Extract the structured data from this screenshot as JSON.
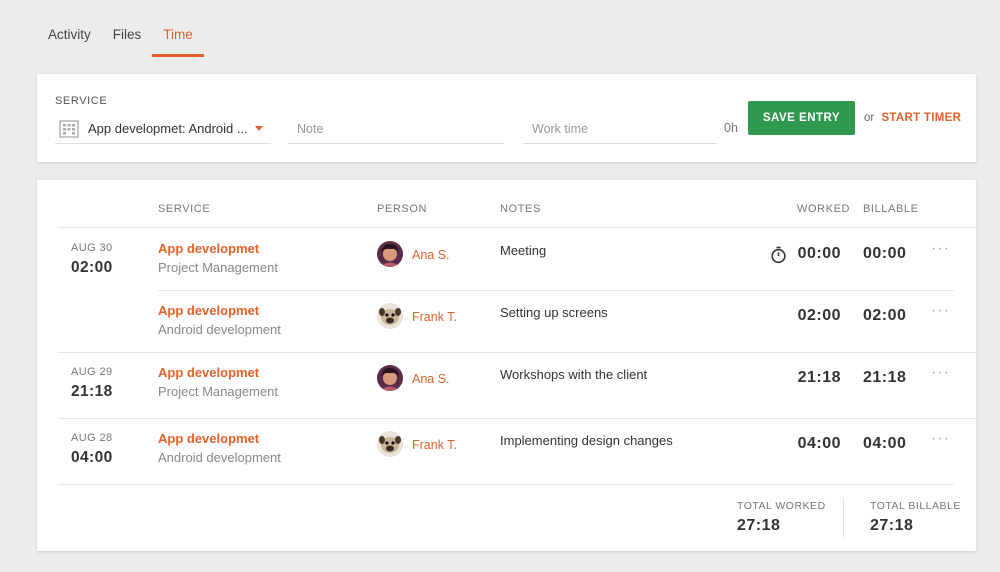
{
  "tabs": [
    {
      "label": "Activity",
      "active": false
    },
    {
      "label": "Files",
      "active": false
    },
    {
      "label": "Time",
      "active": true
    }
  ],
  "entry": {
    "service_label": "SERVICE",
    "service_value": "App developmet: Android ...",
    "note_placeholder": "Note",
    "work_placeholder": "Work time",
    "hours": "0h",
    "save_label": "SAVE ENTRY",
    "or_label": "or",
    "timer_label": "START TIMER"
  },
  "table": {
    "headers": {
      "service": "SERVICE",
      "person": "PERSON",
      "notes": "NOTES",
      "worked": "WORKED",
      "billable": "BILLABLE"
    },
    "rows": [
      {
        "date": "AUG 30",
        "time": "02:00",
        "service": "App developmet",
        "subservice": "Project Management",
        "person": "Ana S.",
        "avatar": "ana",
        "note": "Meeting",
        "worked": "00:00",
        "billable": "00:00",
        "timer_icon": true
      },
      {
        "date": "",
        "time": "",
        "service": "App developmet",
        "subservice": "Android development",
        "person": "Frank T.",
        "avatar": "frank",
        "note": "Setting up screens",
        "worked": "02:00",
        "billable": "02:00",
        "timer_icon": false
      },
      {
        "date": "AUG 29",
        "time": "21:18",
        "service": "App developmet",
        "subservice": "Project Management",
        "person": "Ana S.",
        "avatar": "ana",
        "note": "Workshops with the client",
        "worked": "21:18",
        "billable": "21:18",
        "timer_icon": false
      },
      {
        "date": "AUG 28",
        "time": "04:00",
        "service": "App developmet",
        "subservice": "Android development",
        "person": "Frank T.",
        "avatar": "frank",
        "note": "Implementing design changes",
        "worked": "04:00",
        "billable": "04:00",
        "timer_icon": false
      }
    ],
    "more_label": "···",
    "totals": {
      "worked_label": "TOTAL WORKED",
      "worked": "27:18",
      "billable_label": "TOTAL BILLABLE",
      "billable": "27:18"
    }
  },
  "colors": {
    "accent": "#e2622c",
    "save_button": "#2f9a4f",
    "background": "#ececec"
  },
  "icons": {
    "service": "building-icon",
    "dropdown": "caret-down-icon",
    "timer": "stopwatch-icon",
    "more": "more-horizontal-icon"
  }
}
